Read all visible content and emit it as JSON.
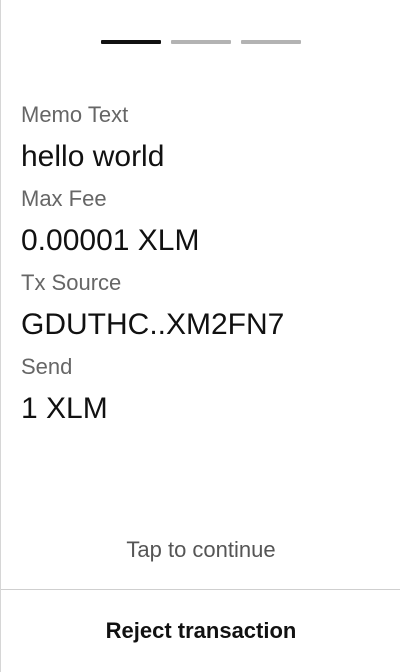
{
  "stepper": {
    "total_steps": 3,
    "current_step": 1,
    "active_color": "#111111",
    "inactive_color": "#b3b3b3"
  },
  "fields": [
    {
      "label": "Memo Text",
      "value": "hello world"
    },
    {
      "label": "Max Fee",
      "value": "0.00001 XLM"
    },
    {
      "label": "Tx Source",
      "value": "GDUTHC..XM2FN7"
    },
    {
      "label": "Send",
      "value": "1 XLM"
    }
  ],
  "tap_to_continue": "Tap to continue",
  "reject_button_label": "Reject transaction"
}
